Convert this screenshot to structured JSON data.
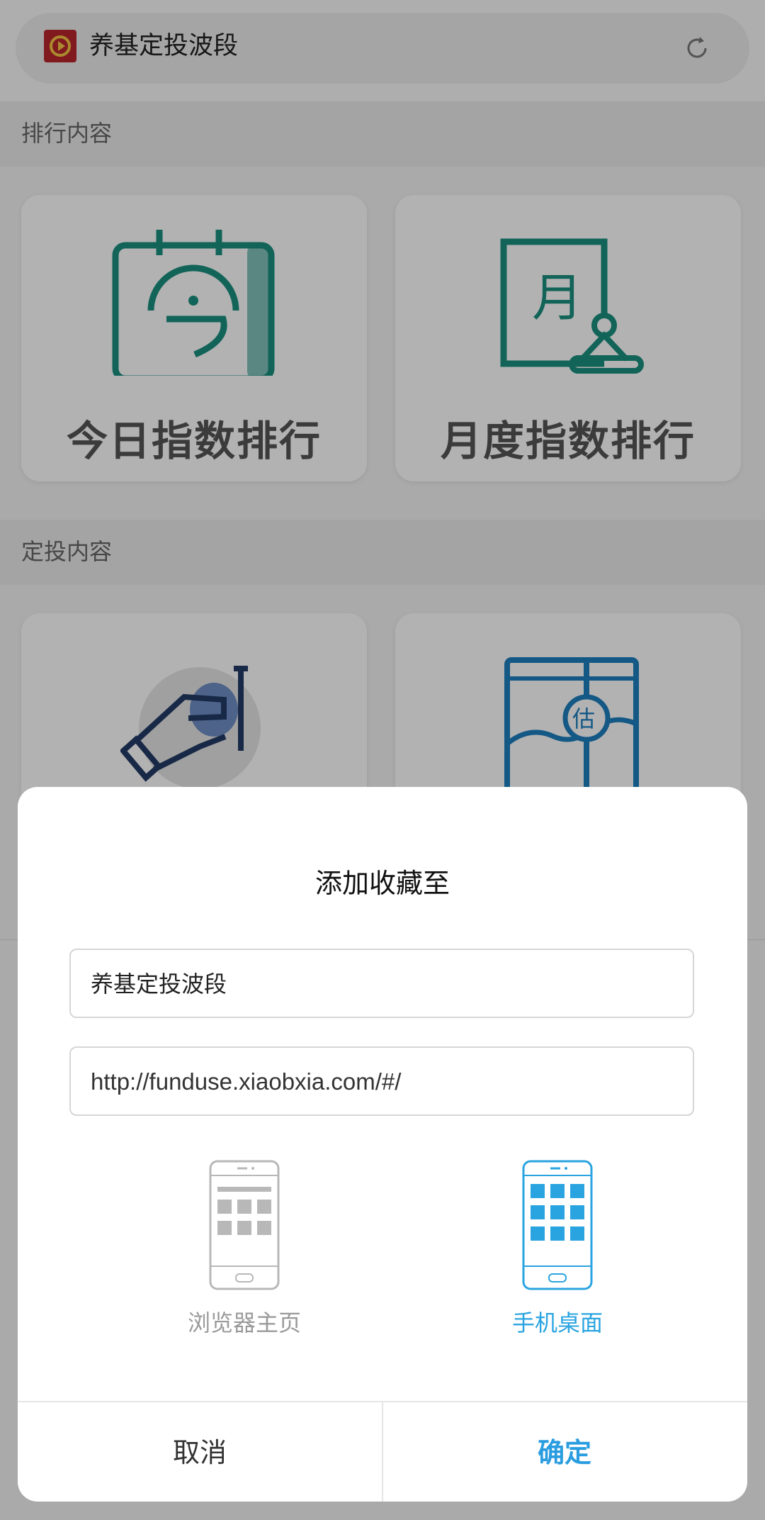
{
  "browser": {
    "page_title": "养基定投波段",
    "icons": {
      "site": "site-logo-icon",
      "reload": "reload-icon"
    }
  },
  "sections": [
    {
      "title": "排行内容",
      "cards": [
        {
          "label": "今日指数排行",
          "icon": "calendar-today-icon"
        },
        {
          "label": "月度指数排行",
          "icon": "calendar-month-icon"
        }
      ]
    },
    {
      "title": "定投内容",
      "cards": [
        {
          "icon": "hand-coin-icon"
        },
        {
          "icon": "estimate-map-icon"
        }
      ]
    }
  ],
  "dialog": {
    "title": "添加收藏至",
    "name_value": "养基定投波段",
    "url_value": "http://funduse.xiaobxia.com/#/",
    "options": [
      {
        "label": "浏览器主页",
        "icon": "phone-grid-icon",
        "selected": false
      },
      {
        "label": "手机桌面",
        "icon": "phone-apps-icon",
        "selected": true
      }
    ],
    "cancel_label": "取消",
    "confirm_label": "确定"
  },
  "colors": {
    "accent": "#2a9de0",
    "icon_teal": "#1b9080",
    "icon_blue": "#1e7fbf",
    "icon_navy": "#233c66",
    "brand_red": "#b9262b"
  }
}
